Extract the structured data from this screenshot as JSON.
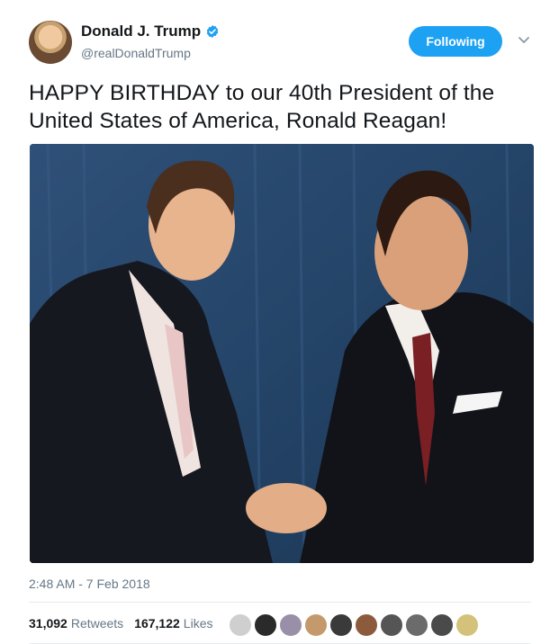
{
  "author": {
    "name": "Donald J. Trump",
    "handle": "@realDonaldTrump"
  },
  "follow_button": "Following",
  "tweet": {
    "text": "HAPPY BIRTHDAY to our 40th President of the United States of America, Ronald Reagan!",
    "timestamp": "2:48 AM - 7 Feb 2018"
  },
  "stats": {
    "retweets": "31,092",
    "retweets_label": "Retweets",
    "likes": "167,122",
    "likes_label": "Likes"
  },
  "colors": {
    "accent": "#1da1f2",
    "muted": "#657786"
  },
  "icons": [
    "verified-badge-icon",
    "chevron-down-icon"
  ]
}
